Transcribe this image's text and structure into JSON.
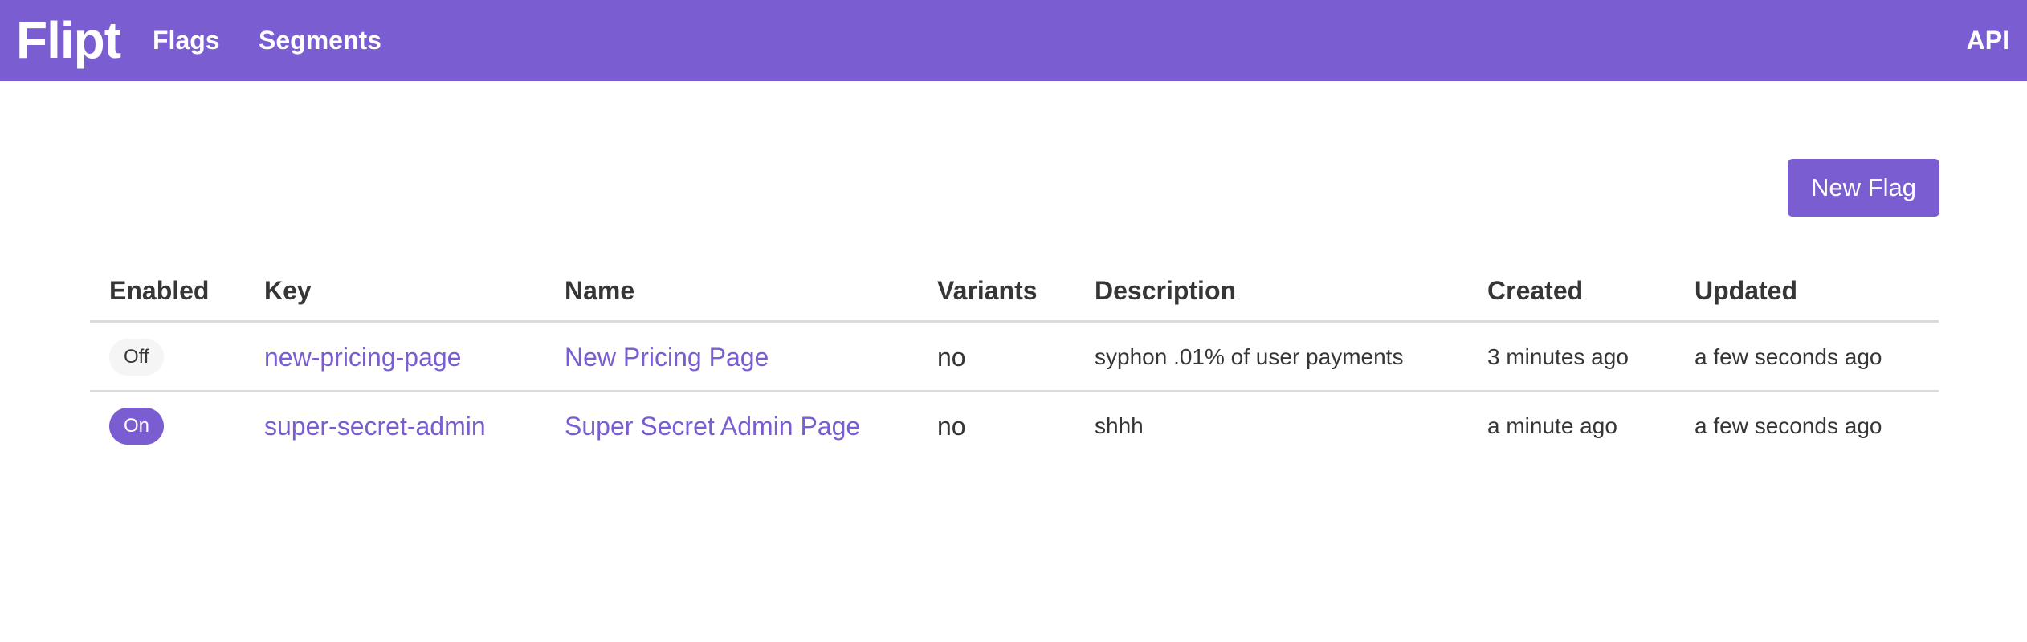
{
  "navbar": {
    "brand": "Flipt",
    "items": [
      {
        "label": "Flags"
      },
      {
        "label": "Segments"
      }
    ],
    "api_label": "API"
  },
  "actions": {
    "new_flag_label": "New Flag"
  },
  "table": {
    "headers": [
      "Enabled",
      "Key",
      "Name",
      "Variants",
      "Description",
      "Created",
      "Updated"
    ],
    "rows": [
      {
        "enabled": "Off",
        "key": "new-pricing-page",
        "name": "New Pricing Page",
        "variants": "no",
        "description": "syphon .01% of user payments",
        "created": "3 minutes ago",
        "updated": "a few seconds ago"
      },
      {
        "enabled": "On",
        "key": "super-secret-admin",
        "name": "Super Secret Admin Page",
        "variants": "no",
        "description": "shhh",
        "created": "a minute ago",
        "updated": "a few seconds ago"
      }
    ]
  },
  "colors": {
    "primary": "#7a5dd1",
    "text": "#363636",
    "tag_off_bg": "#f5f5f5",
    "border": "#dbdbdb"
  }
}
